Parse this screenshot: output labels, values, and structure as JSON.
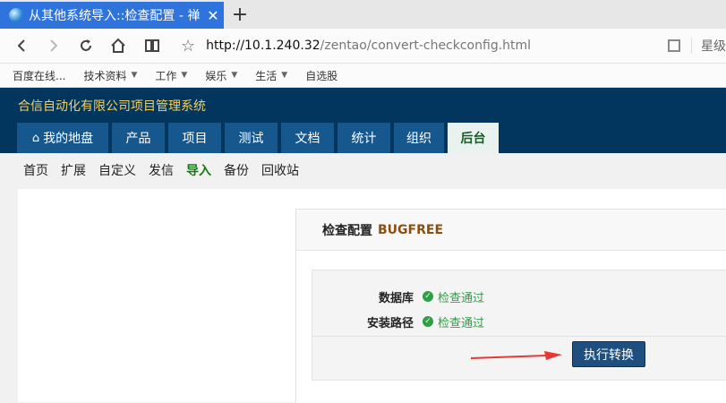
{
  "browser": {
    "tab_title": "从其他系统导入::检查配置 - 禅",
    "tab_close": "✕",
    "new_tab": "+",
    "url_host": "http://10.1.240.32",
    "url_path": "/zentao/convert-checkconfig.html",
    "right_label": "星级",
    "bookmarks": [
      {
        "label": "百度在线..."
      },
      {
        "label": "技术资料",
        "dropdown": true
      },
      {
        "label": "工作",
        "dropdown": true
      },
      {
        "label": "娱乐",
        "dropdown": true
      },
      {
        "label": "生活",
        "dropdown": true
      },
      {
        "label": "自选股"
      }
    ]
  },
  "app": {
    "company": "合信自动化有限公司项目管理系统",
    "nav": [
      {
        "label": "我的地盘",
        "icon": "home-icon"
      },
      {
        "label": "产品"
      },
      {
        "label": "项目"
      },
      {
        "label": "测试"
      },
      {
        "label": "文档"
      },
      {
        "label": "统计"
      },
      {
        "label": "组织"
      },
      {
        "label": "后台",
        "active": true
      }
    ],
    "submenu": [
      {
        "label": "首页"
      },
      {
        "label": "扩展"
      },
      {
        "label": "自定义"
      },
      {
        "label": "发信"
      },
      {
        "label": "导入",
        "active": true
      },
      {
        "label": "备份"
      },
      {
        "label": "回收站"
      }
    ]
  },
  "check": {
    "title": "检查配置",
    "subtitle": "BUGFREE",
    "rows": [
      {
        "label": "数据库",
        "status": "检查通过"
      },
      {
        "label": "安装路径",
        "status": "检查通过"
      }
    ],
    "button": "执行转换"
  },
  "colors": {
    "header_bg": "#03365f",
    "nav_tab": "#16578e",
    "company": "#f4cf5e",
    "success": "#2f9e44",
    "button": "#1e4f7f",
    "arrow": "#e53935"
  }
}
